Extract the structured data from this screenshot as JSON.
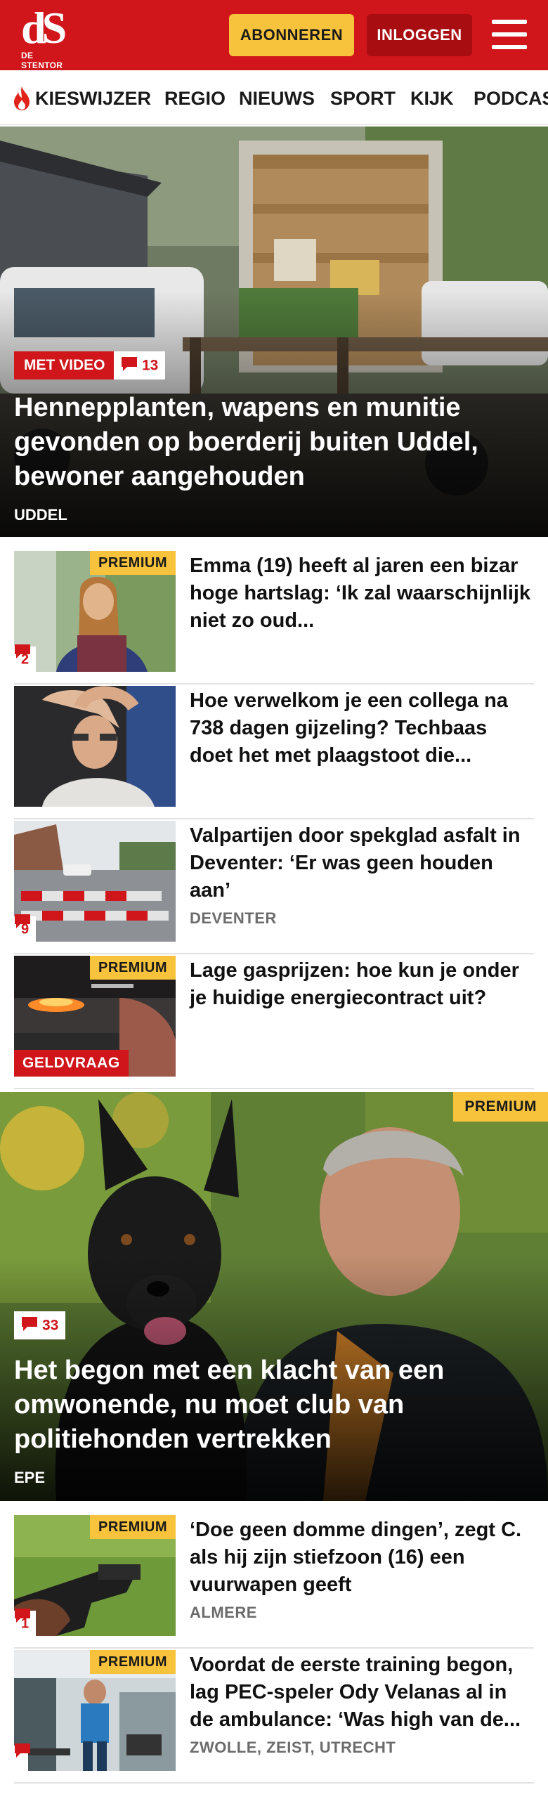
{
  "header": {
    "logo_mark": "dS",
    "logo_sub": "DE STENTOR",
    "subscribe_label": "ABONNEREN",
    "login_label": "INLOGGEN",
    "menu_icon": "hamburger-icon",
    "brand_color": "#d0161b",
    "accent_color": "#f7c33c"
  },
  "nav": {
    "items": [
      "KIESWIJZER",
      "REGIO",
      "NIEUWS",
      "SPORT",
      "KIJK",
      "PODCAS"
    ],
    "first_icon": "flame-icon"
  },
  "hero1": {
    "video_tag": "MET VIDEO",
    "comments": "13",
    "title": "Hennepplanten, wapens en munitie gevonden op boerderij buiten Uddel, bewoner aangehouden",
    "place": "UDDEL"
  },
  "list1": [
    {
      "title": "Emma (19) heeft al jaren een bizar hoge hartslag: ‘Ik zal waarschijnlijk niet zo oud...",
      "premium": "PREMIUM",
      "comments": "2",
      "place": ""
    },
    {
      "title": "Hoe verwelkom je een collega na 738 dagen gijzeling? Techbaas doet het met plaagstoot die...",
      "premium": "",
      "comments": "",
      "place": ""
    },
    {
      "title": "Valpartijen door spekglad asfalt in Deventer: ‘Er was geen houden aan’",
      "premium": "",
      "comments": "9",
      "place": "DEVENTER"
    },
    {
      "title": "Lage gasprijzen: hoe kun je onder je huidige energiecontract uit?",
      "premium": "PREMIUM",
      "comments": "",
      "category": "GELDVRAAG",
      "place": ""
    }
  ],
  "hero2": {
    "premium": "PREMIUM",
    "comments": "33",
    "title": "Het begon met een klacht van een omwonende, nu moet club van politiehonden vertrekken",
    "place": "EPE"
  },
  "list2": [
    {
      "title": "‘Doe geen domme dingen’, zegt C. als hij zijn stiefzoon (16) een vuurwapen geeft",
      "premium": "PREMIUM",
      "comments": "1",
      "place": "ALMERE"
    },
    {
      "title": "Voordat de eerste training begon, lag PEC-speler Ody Velanas al in de ambulance: ‘Was high van de...",
      "premium": "PREMIUM",
      "comments": "",
      "place": "ZWOLLE, ZEIST, UTRECHT"
    }
  ]
}
